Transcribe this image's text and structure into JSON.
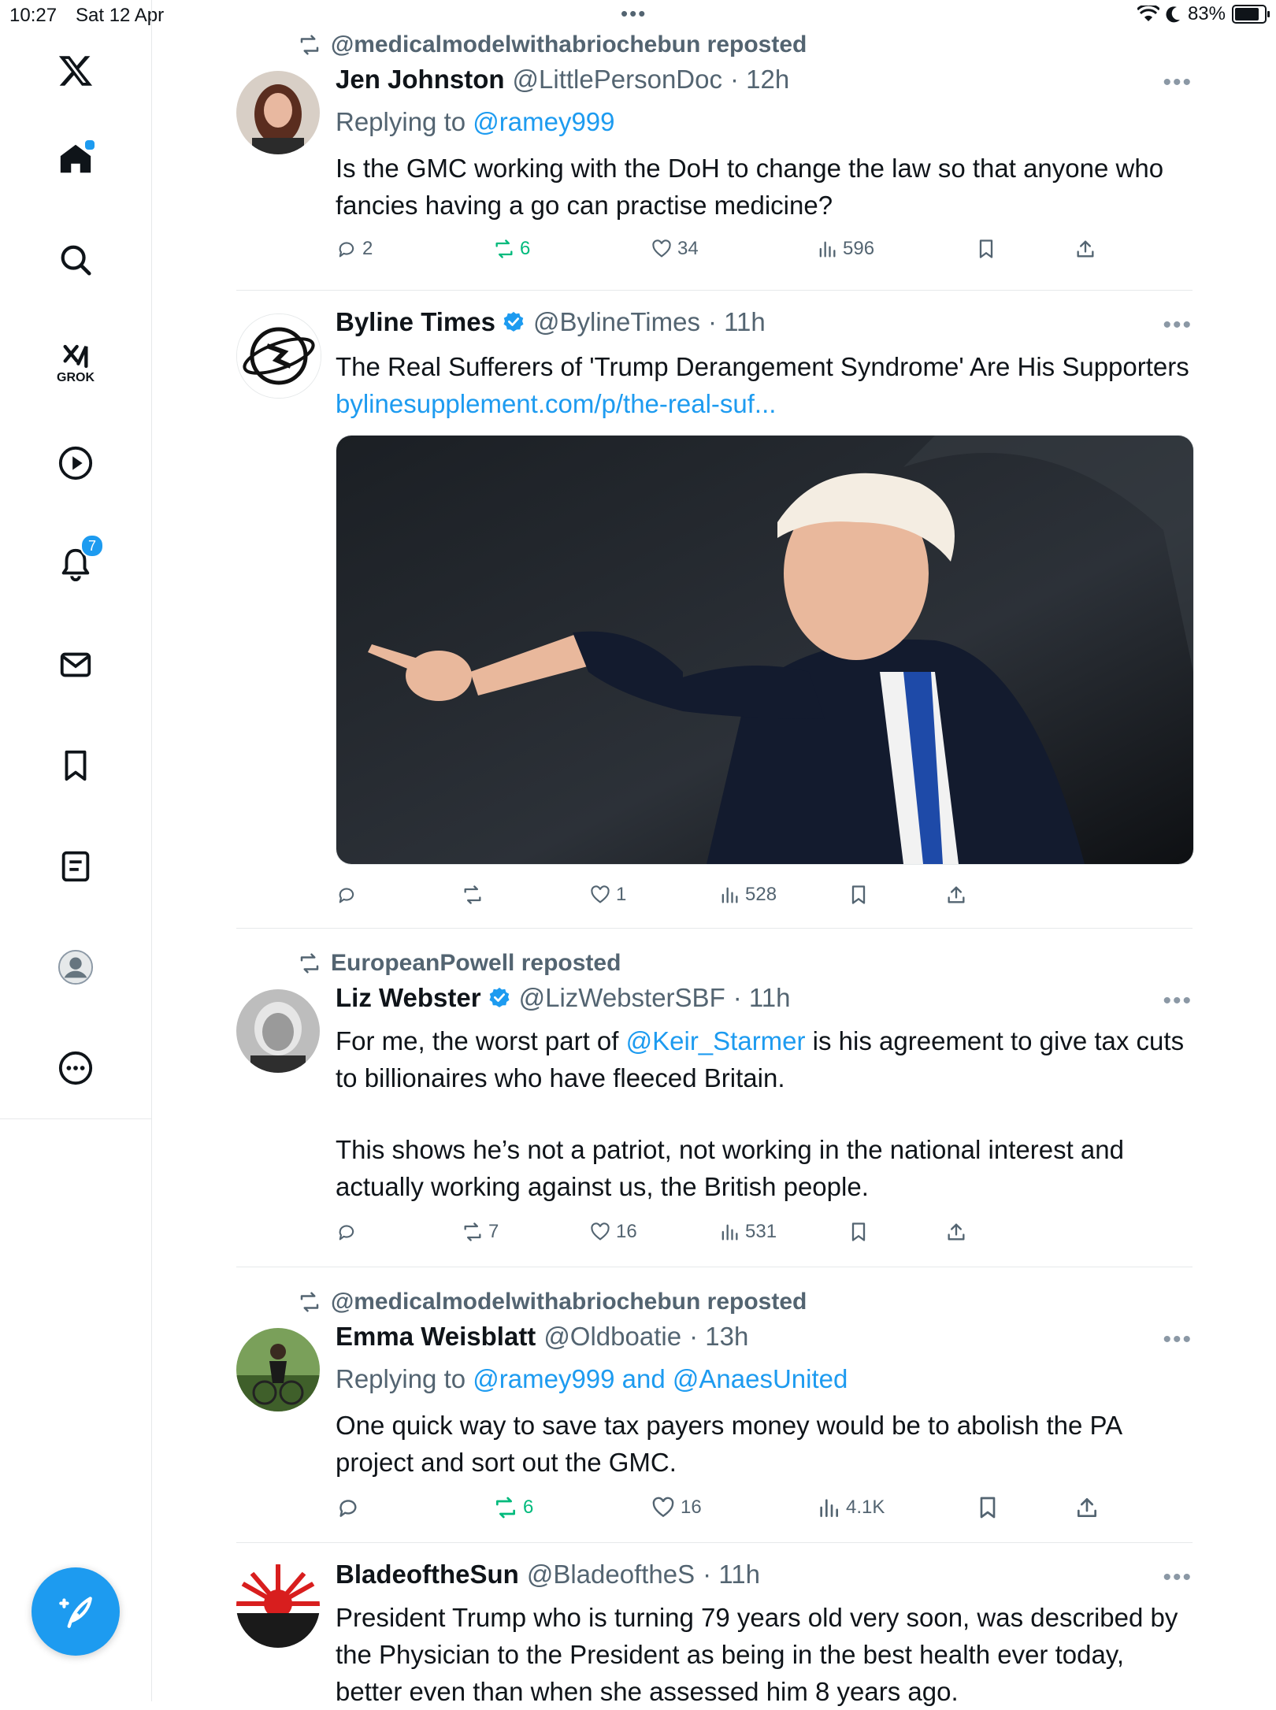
{
  "status_bar": {
    "time": "10:27",
    "date": "Sat 12 Apr",
    "battery": "83%"
  },
  "sidebar": {
    "notifications_badge": "7",
    "grok_label": "GROK"
  },
  "tweets": [
    {
      "repost_by": "@medicalmodelwithabriochebun reposted",
      "name": "Jen Johnston",
      "handle": "@LittlePersonDoc",
      "time": "· 12h",
      "reply_label": "Replying to ",
      "reply_to": "@ramey999",
      "text": "Is the GMC working with the DoH to change the law so that anyone who fancies having a go can practise medicine?",
      "replies": "2",
      "reposts": "6",
      "likes": "34",
      "views": "596"
    },
    {
      "name": "Byline Times",
      "handle": "@BylineTimes",
      "time": "· 11h",
      "text": "The Real Sufferers of 'Trump Derangement Syndrome' Are His Supporters ",
      "link": "bylinesupplement.com/p/the-real-suf...",
      "replies": "",
      "reposts": "",
      "likes": "1",
      "views": "528"
    },
    {
      "repost_by": "EuropeanPowell reposted",
      "name": "Liz Webster",
      "handle": "@LizWebsterSBF",
      "time": "· 11h",
      "text_pre": "For me, the worst part of ",
      "mention": "@Keir_Starmer",
      "text_post": " is his agreement to give tax cuts to billionaires who have fleeced Britain.",
      "text2": "This shows he’s not a patriot, not working in the national interest and actually working against us, the British people.",
      "replies": "",
      "reposts": "7",
      "likes": "16",
      "views": "531"
    },
    {
      "repost_by": "@medicalmodelwithabriochebun reposted",
      "name": "Emma Weisblatt",
      "handle": "@Oldboatie",
      "time": "· 13h",
      "reply_label": "Replying to ",
      "reply_to": "@ramey999 and @AnaesUnited",
      "text": "One quick way to save tax payers money would be to abolish the PA project and sort out the GMC.",
      "replies": "",
      "reposts": "6",
      "likes": "16",
      "views": "4.1K"
    },
    {
      "name": "BladeoftheSun",
      "handle": "@BladeoftheS",
      "time": "· 11h",
      "text": "President Trump who is turning 79 years old very soon, was described by the Physician to the President as being in the best health ever today, better even than when she assessed him 8 years ago."
    }
  ],
  "colors": {
    "accent": "#1d9bf0",
    "repost_green": "#00ba7c",
    "secondary_text": "#536471"
  }
}
